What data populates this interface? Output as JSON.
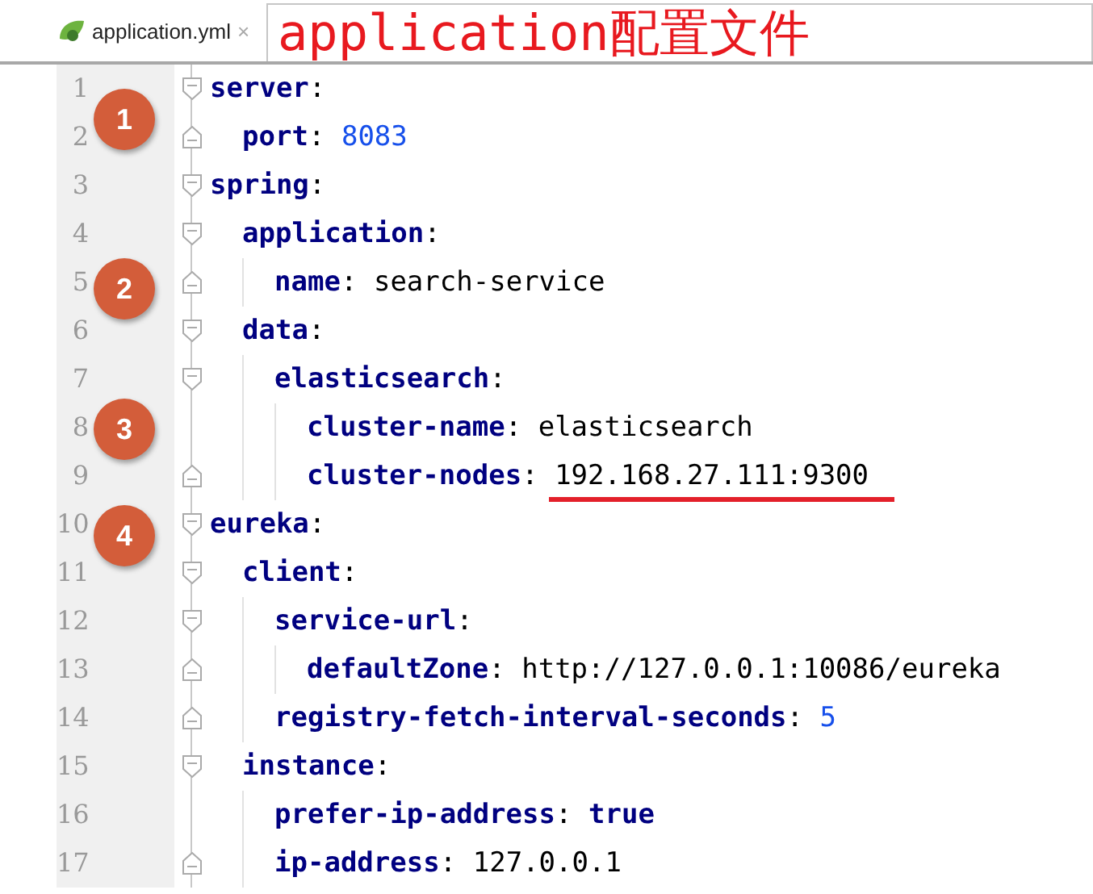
{
  "tab": {
    "label": "application.yml",
    "close": "×",
    "selected": true
  },
  "banner": {
    "title": "application配置文件"
  },
  "editor": {
    "line_numbers": [
      "1",
      "2",
      "3",
      "4",
      "5",
      "6",
      "7",
      "8",
      "9",
      "10",
      "11",
      "12",
      "13",
      "14",
      "15",
      "16",
      "17"
    ],
    "tree": [
      {
        "key": "server",
        "colon": ":",
        "children": [
          {
            "key": "port",
            "colon": ":",
            "value": "8083",
            "kind": "number"
          }
        ]
      },
      {
        "key": "spring",
        "colon": ":",
        "children": [
          {
            "key": "application",
            "colon": ":",
            "children": [
              {
                "key": "name",
                "colon": ":",
                "value": "search-service",
                "kind": "string"
              }
            ]
          },
          {
            "key": "data",
            "colon": ":",
            "children": [
              {
                "key": "elasticsearch",
                "colon": ":",
                "children": [
                  {
                    "key": "cluster-name",
                    "colon": ":",
                    "value": "elasticsearch",
                    "kind": "string"
                  },
                  {
                    "key": "cluster-nodes",
                    "colon": ":",
                    "value": "192.168.27.111:9300",
                    "kind": "string",
                    "underlined": true
                  }
                ]
              }
            ]
          }
        ]
      },
      {
        "key": "eureka",
        "colon": ":",
        "children": [
          {
            "key": "client",
            "colon": ":",
            "children": [
              {
                "key": "service-url",
                "colon": ":",
                "children": [
                  {
                    "key": "defaultZone",
                    "colon": ":",
                    "value": "http://127.0.0.1:10086/eureka",
                    "kind": "string"
                  }
                ]
              },
              {
                "key": "registry-fetch-interval-seconds",
                "colon": ":",
                "value": "5",
                "kind": "number"
              }
            ]
          },
          {
            "key": "instance",
            "colon": ":",
            "children": [
              {
                "key": "prefer-ip-address",
                "colon": ":",
                "value": "true",
                "kind": "boolean"
              },
              {
                "key": "ip-address",
                "colon": ":",
                "value": "127.0.0.1",
                "kind": "string"
              }
            ]
          }
        ]
      }
    ],
    "badges": [
      {
        "label": "1"
      },
      {
        "label": "2"
      },
      {
        "label": "3"
      },
      {
        "label": "4"
      }
    ]
  }
}
